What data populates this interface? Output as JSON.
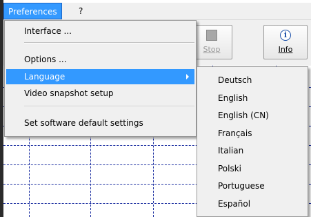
{
  "menubar": {
    "items": [
      {
        "label": "Preferences"
      },
      {
        "label": "?"
      }
    ]
  },
  "toolbar": {
    "buttons": [
      {
        "label": "Stop",
        "icon": "stop-icon",
        "state": "disabled"
      },
      {
        "label": "Info",
        "icon": "info-icon"
      }
    ]
  },
  "preferences_menu": {
    "items": [
      {
        "label": "Interface ..."
      },
      {
        "label": "Options ..."
      },
      {
        "label": "Language"
      },
      {
        "label": "Video snapshot setup"
      },
      {
        "label": "Set software default settings"
      }
    ]
  },
  "language_submenu": {
    "items": [
      {
        "label": "Deutsch"
      },
      {
        "label": "English"
      },
      {
        "label": "English (CN)"
      },
      {
        "label": "Français"
      },
      {
        "label": "Italian"
      },
      {
        "label": "Polski"
      },
      {
        "label": "Portuguese"
      },
      {
        "label": "Español"
      }
    ]
  },
  "colors": {
    "menu_highlight": "#3399ff",
    "grid_line": "#1c2fa1",
    "menu_background": "#f0f0f0"
  }
}
